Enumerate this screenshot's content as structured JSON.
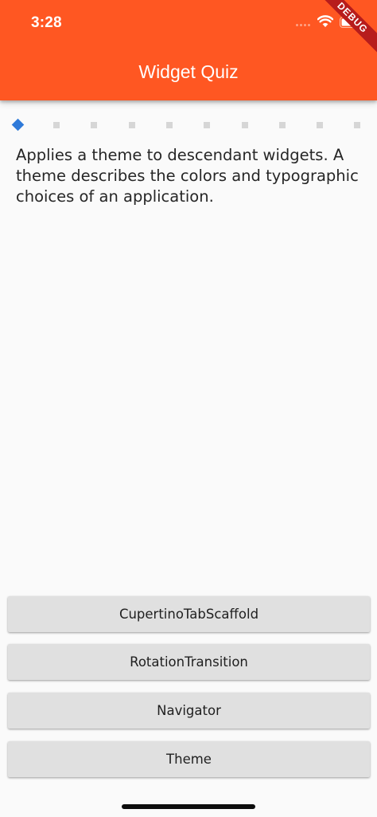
{
  "status_bar": {
    "time": "3:28"
  },
  "debug_banner": "DEBUG",
  "app_bar": {
    "title": "Widget Quiz",
    "color": "#ff5722"
  },
  "progress": {
    "total": 10,
    "current": 1,
    "active_color": "#2f7ad9"
  },
  "question": {
    "text": "Applies a theme to descendant widgets. A theme describes the colors and typographic choices of an application."
  },
  "answers": [
    "CupertinoTabScaffold",
    "RotationTransition",
    "Navigator",
    "Theme"
  ]
}
